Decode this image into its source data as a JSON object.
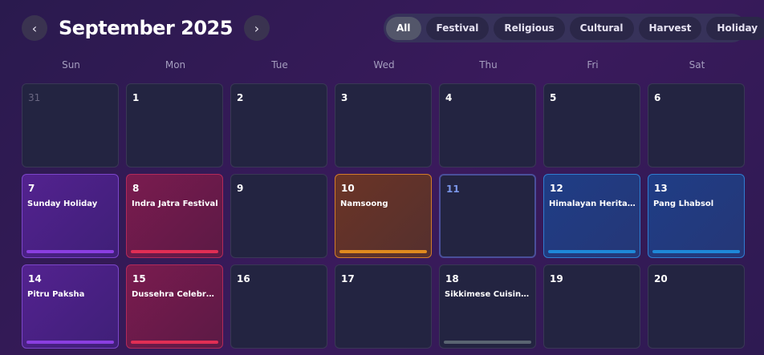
{
  "header": {
    "title": "September 2025",
    "prev_label": "‹",
    "next_label": "›"
  },
  "filters": [
    {
      "label": "All",
      "active": true
    },
    {
      "label": "Festival",
      "active": false
    },
    {
      "label": "Religious",
      "active": false
    },
    {
      "label": "Cultural",
      "active": false
    },
    {
      "label": "Harvest",
      "active": false
    },
    {
      "label": "Holiday",
      "active": false
    }
  ],
  "weekdays": [
    "Sun",
    "Mon",
    "Tue",
    "Wed",
    "Thu",
    "Fri",
    "Sat"
  ],
  "colors": {
    "purple": "#8a3ee0",
    "red": "#e02e54",
    "orange": "#e08a1e",
    "blue": "#1e88d8",
    "grey": "#5a6472",
    "today": "#7b96e8"
  },
  "days": [
    {
      "day": "31",
      "outside_month": true
    },
    {
      "day": "1"
    },
    {
      "day": "2"
    },
    {
      "day": "3"
    },
    {
      "day": "4"
    },
    {
      "day": "5"
    },
    {
      "day": "6"
    },
    {
      "day": "7",
      "event": "Sunday Holiday",
      "color": "purple"
    },
    {
      "day": "8",
      "event": "Indra Jatra Festival",
      "color": "red"
    },
    {
      "day": "9"
    },
    {
      "day": "10",
      "event": "Namsoong",
      "color": "orange"
    },
    {
      "day": "11",
      "today": true
    },
    {
      "day": "12",
      "event": "Himalayan Heritage Day",
      "color": "blue"
    },
    {
      "day": "13",
      "event": "Pang Lhabsol",
      "color": "blue"
    },
    {
      "day": "14",
      "event": "Pitru Paksha",
      "color": "purple"
    },
    {
      "day": "15",
      "event": "Dussehra Celebration",
      "color": "red"
    },
    {
      "day": "16"
    },
    {
      "day": "17"
    },
    {
      "day": "18",
      "event": "Sikkimese Cuisine Festival",
      "color": "grey"
    },
    {
      "day": "19"
    },
    {
      "day": "20"
    }
  ]
}
